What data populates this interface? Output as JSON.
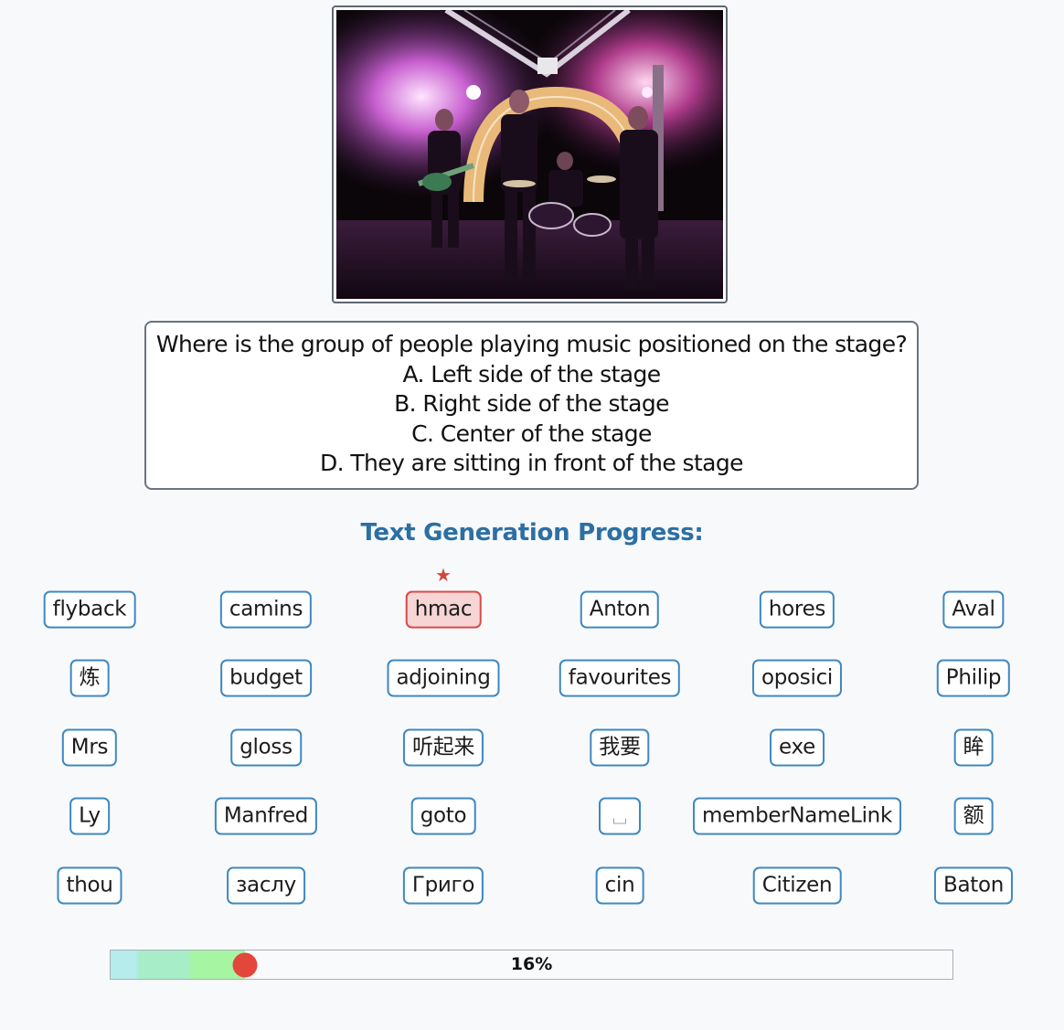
{
  "question": {
    "text": "Where is the group of people playing music positioned on the stage?",
    "options": [
      "A. Left side of the stage",
      "B. Right side of the stage",
      "C. Center of the stage",
      "D. They are sitting in front of the stage"
    ]
  },
  "progress_title": "Text Generation Progress:",
  "tokens": [
    [
      "flyback",
      "camins",
      "hmac",
      "Anton",
      "hores",
      "Aval"
    ],
    [
      "炼",
      "budget",
      "adjoining",
      "favourites",
      "oposici",
      "Philip"
    ],
    [
      "Mrs",
      "gloss",
      "听起来",
      "我要",
      "exe",
      "眸"
    ],
    [
      "Ly",
      "Manfred",
      "goto",
      " ",
      "memberNameLink",
      "额"
    ],
    [
      "thou",
      "заслу",
      "Григо",
      "cin",
      "Citizen",
      "Baton"
    ]
  ],
  "active_token": "hmac",
  "progress": {
    "percent_label": "16%",
    "fraction": 0.16
  },
  "colors": {
    "accent_title": "#2c6fa3",
    "token_border": "#3f88c0",
    "active_bg": "#f7d5d5",
    "active_border": "#d84a4a",
    "knob": "#e3463a"
  },
  "icons": {
    "active_marker": "star-icon",
    "space_token": "space-icon"
  }
}
